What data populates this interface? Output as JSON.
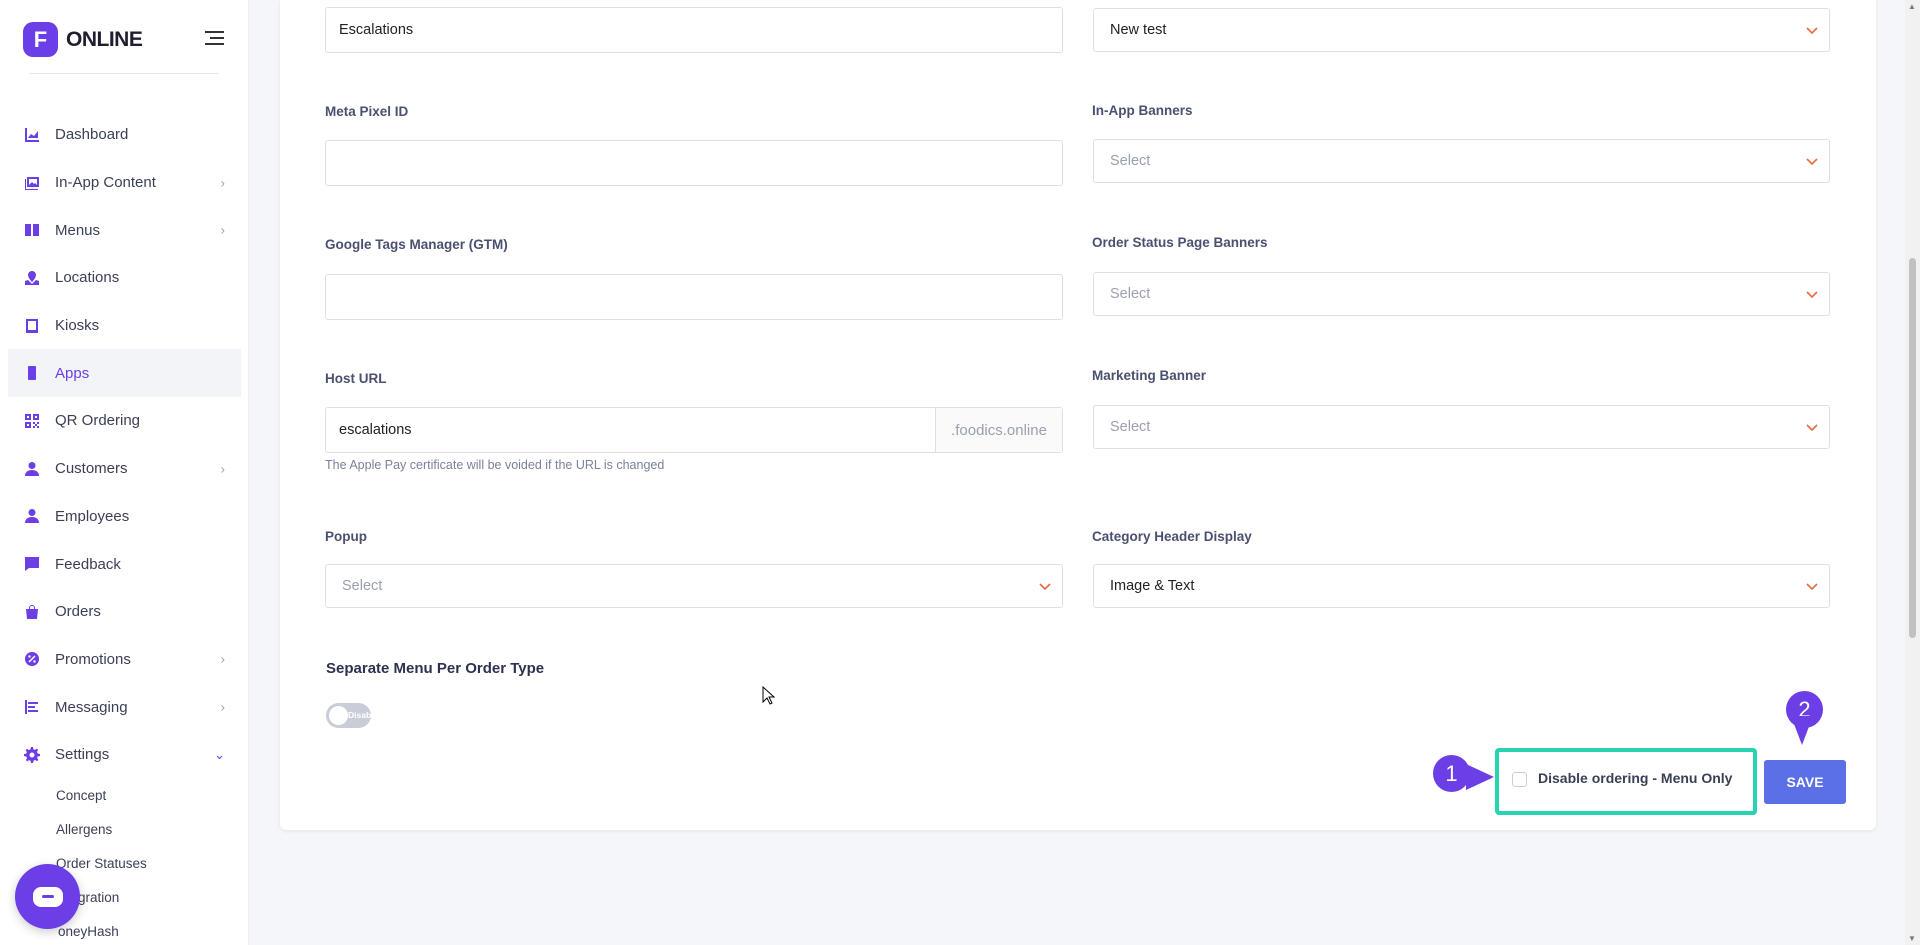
{
  "brand": {
    "logo_letter": "F",
    "name": "ONLINE",
    "accent": "#6b3ee6"
  },
  "sidebar": {
    "items": [
      {
        "label": "Dashboard",
        "icon": "chart-icon",
        "chevron": false
      },
      {
        "label": "In-App Content",
        "icon": "images-icon",
        "chevron": true
      },
      {
        "label": "Menus",
        "icon": "book-icon",
        "chevron": true
      },
      {
        "label": "Locations",
        "icon": "map-pin-icon",
        "chevron": false
      },
      {
        "label": "Kiosks",
        "icon": "tablet-icon",
        "chevron": false
      },
      {
        "label": "Apps",
        "icon": "mobile-icon",
        "chevron": false,
        "active": true
      },
      {
        "label": "QR Ordering",
        "icon": "qr-icon",
        "chevron": false
      },
      {
        "label": "Customers",
        "icon": "user-icon",
        "chevron": true
      },
      {
        "label": "Employees",
        "icon": "user-tie-icon",
        "chevron": false
      },
      {
        "label": "Feedback",
        "icon": "comment-icon",
        "chevron": false
      },
      {
        "label": "Orders",
        "icon": "bag-icon",
        "chevron": false
      },
      {
        "label": "Promotions",
        "icon": "percent-icon",
        "chevron": true
      },
      {
        "label": "Messaging",
        "icon": "message-lines-icon",
        "chevron": true
      },
      {
        "label": "Settings",
        "icon": "gear-icon",
        "chevron": true,
        "open": true
      }
    ],
    "sub_items": [
      "Concept",
      "Allergens",
      "Order Statuses",
      "Integration",
      "MoneyHash"
    ],
    "sub_items_visible": [
      "Concept",
      "Allergens",
      "Order Statuses",
      "gration",
      "oneyHash"
    ]
  },
  "form": {
    "top_left_value": "Escalations",
    "top_right_value": "New test",
    "meta_pixel_label": "Meta Pixel ID",
    "meta_pixel_value": "",
    "in_app_banners_label": "In-App Banners",
    "in_app_banners_placeholder": "Select",
    "gtm_label": "Google Tags Manager (GTM)",
    "gtm_value": "",
    "order_status_banners_label": "Order Status Page Banners",
    "order_status_banners_placeholder": "Select",
    "host_url_label": "Host URL",
    "host_url_value": "escalations",
    "host_url_suffix": ".foodics.online",
    "host_url_hint": "The Apple Pay certificate will be voided if the URL is changed",
    "marketing_banner_label": "Marketing Banner",
    "marketing_banner_placeholder": "Select",
    "popup_label": "Popup",
    "popup_placeholder": "Select",
    "category_header_label": "Category Header Display",
    "category_header_value": "Image & Text",
    "separate_menu_title": "Separate Menu Per Order Type",
    "separate_menu_toggle": "Disabled",
    "disable_ordering_label": "Disable ordering - Menu Only",
    "save_label": "SAVE"
  },
  "annotations": {
    "marker_1": "1",
    "marker_2": "2",
    "marker_color": "#6b3ee6",
    "highlight_color": "#27d3b0"
  }
}
